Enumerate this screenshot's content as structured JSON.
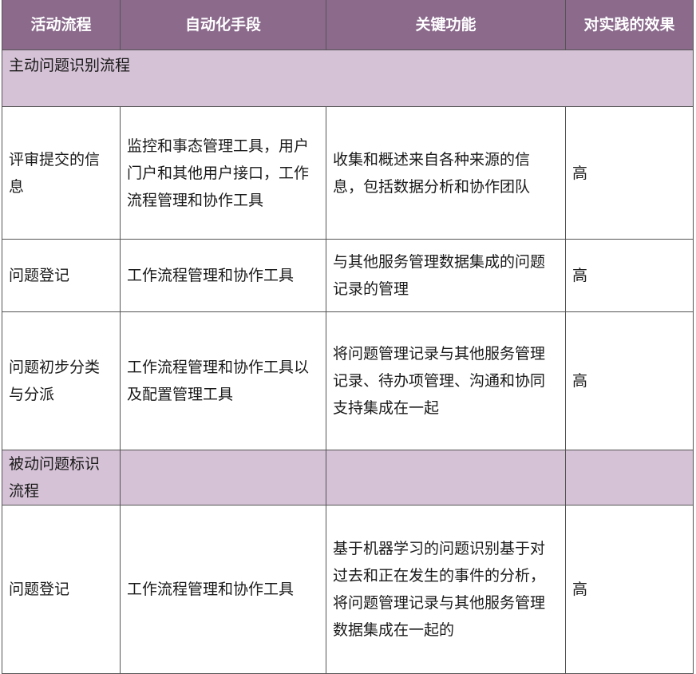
{
  "headers": [
    "活动流程",
    "自动化手段",
    "关键功能",
    "对实践的效果"
  ],
  "sections": [
    {
      "title": "主动问题识别流程",
      "rows": [
        {
          "activity": "评审提交的信息",
          "means": "监控和事态管理工具，用户门户和其他用户接口，工作流程管理和协作工具",
          "function": "收集和概述来自各种来源的信息，包括数据分析和协作团队",
          "effect": "高"
        },
        {
          "activity": "问题登记",
          "means": "工作流程管理和协作工具",
          "function": "与其他服务管理数据集成的问题记录的管理",
          "effect": "高"
        },
        {
          "activity": "问题初步分类与分派",
          "means": "工作流程管理和协作工具以及配置管理工具",
          "function": "将问题管理记录与其他服务管理记录、待办项管理、沟通和协同支持集成在一起",
          "effect": "高"
        }
      ]
    },
    {
      "title": "被动问题标识流程",
      "rows": [
        {
          "activity": "问题登记",
          "means": "工作流程管理和协作工具",
          "function": "基于机器学习的问题识别基于对过去和正在发生的事件的分析，将问题管理记录与其他服务管理数据集成在一起的",
          "effect": "高"
        }
      ]
    }
  ]
}
